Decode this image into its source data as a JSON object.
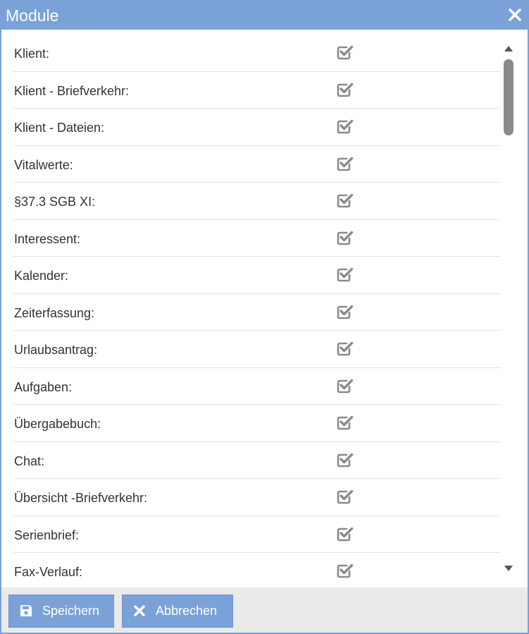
{
  "dialog": {
    "title": "Module",
    "close_icon": "close-icon"
  },
  "modules": [
    {
      "label": "Klient:",
      "checked": true
    },
    {
      "label": "Klient - Briefverkehr:",
      "checked": true
    },
    {
      "label": "Klient - Dateien:",
      "checked": true
    },
    {
      "label": "Vitalwerte:",
      "checked": true
    },
    {
      "label": "§37.3 SGB XI:",
      "checked": true
    },
    {
      "label": "Interessent:",
      "checked": true
    },
    {
      "label": "Kalender:",
      "checked": true
    },
    {
      "label": "Zeiterfassung:",
      "checked": true
    },
    {
      "label": "Urlaubsantrag:",
      "checked": true
    },
    {
      "label": "Aufgaben:",
      "checked": true
    },
    {
      "label": "Übergabebuch:",
      "checked": true
    },
    {
      "label": "Chat:",
      "checked": true
    },
    {
      "label": "Übersicht -Briefverkehr:",
      "checked": true
    },
    {
      "label": "Serienbrief:",
      "checked": true
    },
    {
      "label": "Fax-Verlauf:",
      "checked": true
    }
  ],
  "footer": {
    "save_label": "Speichern",
    "save_icon": "floppy-disk-icon",
    "cancel_label": "Abbrechen",
    "cancel_icon": "x-icon"
  },
  "colors": {
    "accent": "#7aa2d8",
    "footer_bg": "#eaeaea",
    "checkbox": "#8a8a8a",
    "text": "#333333"
  }
}
